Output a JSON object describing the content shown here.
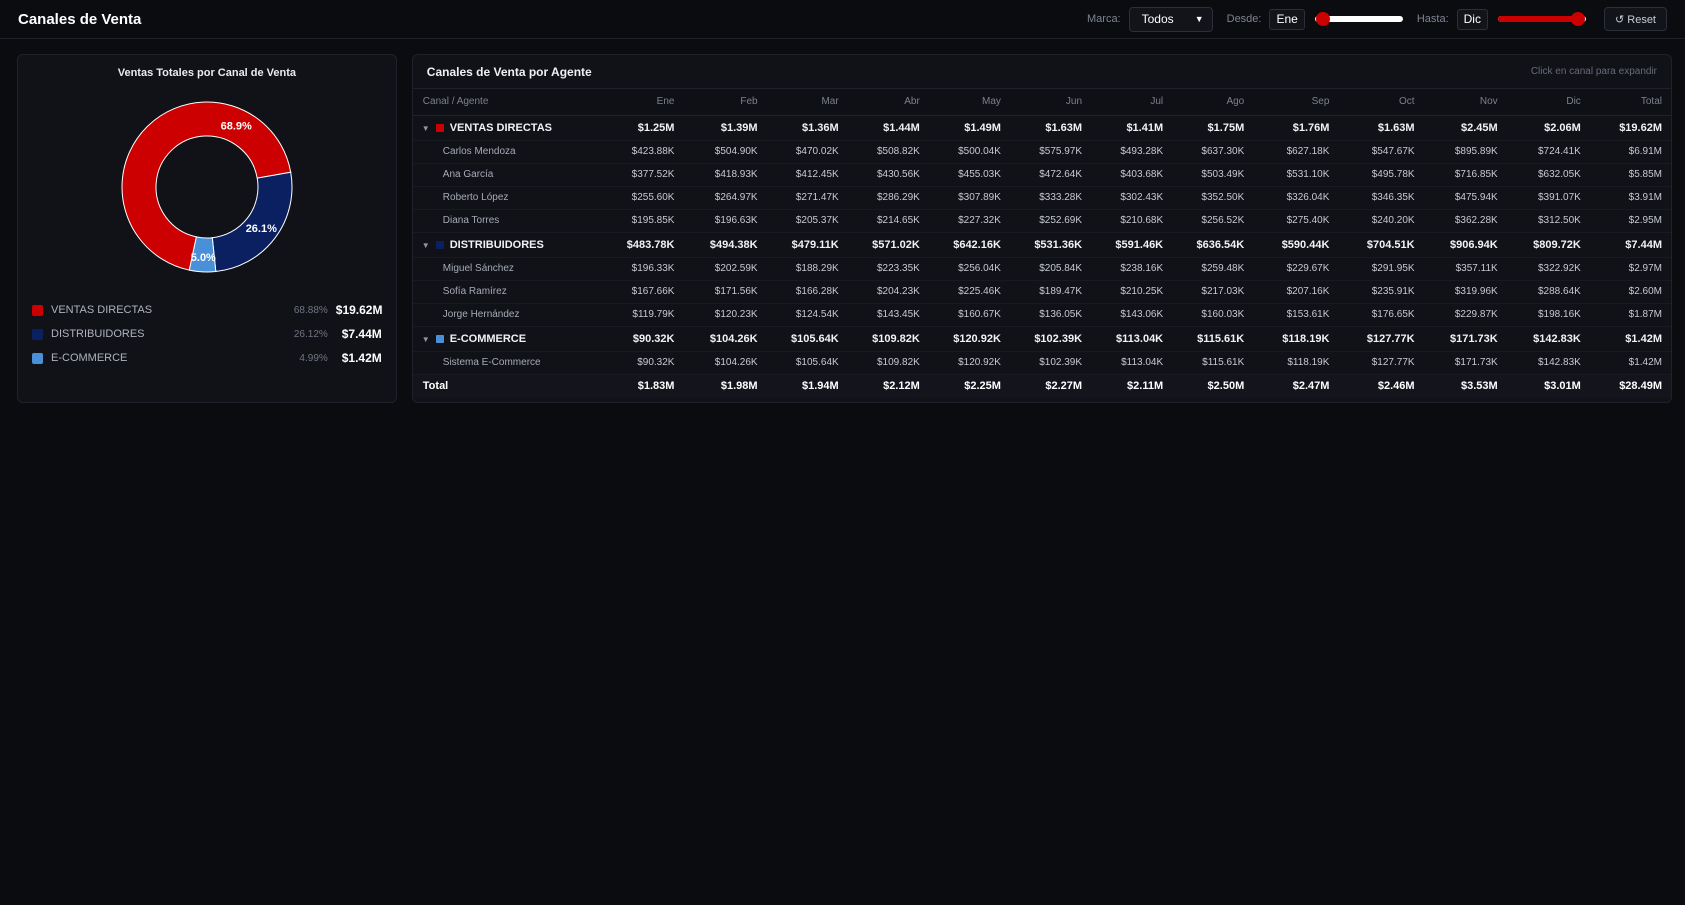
{
  "app": {
    "title": "Canales de Venta"
  },
  "filters": {
    "brand_label": "Marca:",
    "brand_value": "Todos",
    "from_label": "Desde:",
    "from_value": "Ene",
    "from_level_pct": 0,
    "to_label": "Hasta:",
    "to_value": "Dic",
    "to_level_pct": 100,
    "reset_label": "↺ Reset"
  },
  "colors": {
    "ventas_directas": "#cc0000",
    "distribuidores": "#0a2060",
    "ecommerce": "#4a90d9",
    "accent_red": "#d11414"
  },
  "left": {
    "title": "Ventas Totales por Canal de Venta",
    "legend": [
      {
        "name": "VENTAS DIRECTAS",
        "pct": "68.88%",
        "value": "$19.62M"
      },
      {
        "name": "DISTRIBUIDORES",
        "pct": "26.12%",
        "value": "$7.44M"
      },
      {
        "name": "E-COMMERCE",
        "pct": "4.99%",
        "value": "$1.42M"
      }
    ]
  },
  "chart_data": {
    "type": "pie",
    "title": "Ventas Totales por Canal de Venta",
    "labels": [
      "VENTAS DIRECTAS",
      "DISTRIBUIDORES",
      "E-COMMERCE"
    ],
    "values": [
      68.88,
      26.12,
      4.99
    ],
    "slice_labels": [
      "68.9%",
      "26.1%",
      "5.0%"
    ],
    "colors": [
      "#cc0000",
      "#0a2060",
      "#4a90d9"
    ],
    "donut": true
  },
  "right": {
    "title": "Canales de Venta por Agente",
    "hint": "Click en canal para expandir",
    "columns": [
      "Canal / Agente",
      "Ene",
      "Feb",
      "Mar",
      "Abr",
      "May",
      "Jun",
      "Jul",
      "Ago",
      "Sep",
      "Oct",
      "Nov",
      "Dic",
      "Total"
    ],
    "rows": [
      {
        "type": "channel",
        "color": "#cc0000",
        "name": "VENTAS DIRECTAS",
        "values": [
          "$1.25M",
          "$1.39M",
          "$1.36M",
          "$1.44M",
          "$1.49M",
          "$1.63M",
          "$1.41M",
          "$1.75M",
          "$1.76M",
          "$1.63M",
          "$2.45M",
          "$2.06M"
        ],
        "total": "$19.62M"
      },
      {
        "type": "agent",
        "name": "Carlos Mendoza",
        "values": [
          "$423.88K",
          "$504.90K",
          "$470.02K",
          "$508.82K",
          "$500.04K",
          "$575.97K",
          "$493.28K",
          "$637.30K",
          "$627.18K",
          "$547.67K",
          "$895.89K",
          "$724.41K"
        ],
        "total": "$6.91M"
      },
      {
        "type": "agent",
        "name": "Ana García",
        "values": [
          "$377.52K",
          "$418.93K",
          "$412.45K",
          "$430.56K",
          "$455.03K",
          "$472.64K",
          "$403.68K",
          "$503.49K",
          "$531.10K",
          "$495.78K",
          "$716.85K",
          "$632.05K"
        ],
        "total": "$5.85M"
      },
      {
        "type": "agent",
        "name": "Roberto López",
        "values": [
          "$255.60K",
          "$264.97K",
          "$271.47K",
          "$286.29K",
          "$307.89K",
          "$333.28K",
          "$302.43K",
          "$352.50K",
          "$326.04K",
          "$346.35K",
          "$475.94K",
          "$391.07K"
        ],
        "total": "$3.91M"
      },
      {
        "type": "agent",
        "name": "Diana Torres",
        "values": [
          "$195.85K",
          "$196.63K",
          "$205.37K",
          "$214.65K",
          "$227.32K",
          "$252.69K",
          "$210.68K",
          "$256.52K",
          "$275.40K",
          "$240.20K",
          "$362.28K",
          "$312.50K"
        ],
        "total": "$2.95M"
      },
      {
        "type": "channel",
        "color": "#0a2060",
        "name": "DISTRIBUIDORES",
        "values": [
          "$483.78K",
          "$494.38K",
          "$479.11K",
          "$571.02K",
          "$642.16K",
          "$531.36K",
          "$591.46K",
          "$636.54K",
          "$590.44K",
          "$704.51K",
          "$906.94K",
          "$809.72K"
        ],
        "total": "$7.44M"
      },
      {
        "type": "agent",
        "name": "Miguel Sánchez",
        "values": [
          "$196.33K",
          "$202.59K",
          "$188.29K",
          "$223.35K",
          "$256.04K",
          "$205.84K",
          "$238.16K",
          "$259.48K",
          "$229.67K",
          "$291.95K",
          "$357.11K",
          "$322.92K"
        ],
        "total": "$2.97M"
      },
      {
        "type": "agent",
        "name": "Sofía Ramírez",
        "values": [
          "$167.66K",
          "$171.56K",
          "$166.28K",
          "$204.23K",
          "$225.46K",
          "$189.47K",
          "$210.25K",
          "$217.03K",
          "$207.16K",
          "$235.91K",
          "$319.96K",
          "$288.64K"
        ],
        "total": "$2.60M"
      },
      {
        "type": "agent",
        "name": "Jorge Hernández",
        "values": [
          "$119.79K",
          "$120.23K",
          "$124.54K",
          "$143.45K",
          "$160.67K",
          "$136.05K",
          "$143.06K",
          "$160.03K",
          "$153.61K",
          "$176.65K",
          "$229.87K",
          "$198.16K"
        ],
        "total": "$1.87M"
      },
      {
        "type": "channel",
        "color": "#4a90d9",
        "name": "E-COMMERCE",
        "values": [
          "$90.32K",
          "$104.26K",
          "$105.64K",
          "$109.82K",
          "$120.92K",
          "$102.39K",
          "$113.04K",
          "$115.61K",
          "$118.19K",
          "$127.77K",
          "$171.73K",
          "$142.83K"
        ],
        "total": "$1.42M"
      },
      {
        "type": "agent",
        "name": "Sistema E-Commerce",
        "values": [
          "$90.32K",
          "$104.26K",
          "$105.64K",
          "$109.82K",
          "$120.92K",
          "$102.39K",
          "$113.04K",
          "$115.61K",
          "$118.19K",
          "$127.77K",
          "$171.73K",
          "$142.83K"
        ],
        "total": "$1.42M"
      }
    ],
    "totals": {
      "name": "Total",
      "values": [
        "$1.83M",
        "$1.98M",
        "$1.94M",
        "$2.12M",
        "$2.25M",
        "$2.27M",
        "$2.11M",
        "$2.50M",
        "$2.47M",
        "$2.46M",
        "$3.53M",
        "$3.01M"
      ],
      "total": "$28.49M"
    }
  }
}
